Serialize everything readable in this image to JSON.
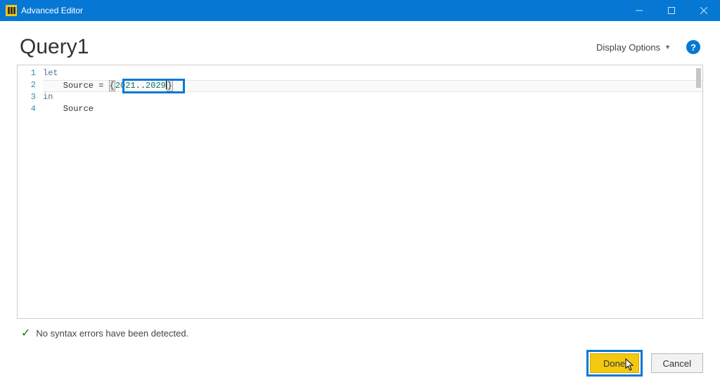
{
  "titlebar": {
    "title": "Advanced Editor"
  },
  "header": {
    "query_name": "Query1",
    "display_options_label": "Display Options",
    "help_char": "?"
  },
  "editor": {
    "line_numbers": [
      "1",
      "2",
      "3",
      "4"
    ],
    "lines": {
      "l1_kw": "let",
      "l2_prefix": "    Source = ",
      "l2_brace_open": "{",
      "l2_num1": "2021",
      "l2_dots": "..",
      "l2_num2": "2029",
      "l2_brace_close": "}",
      "l3_kw": "in",
      "l4": "    Source"
    }
  },
  "status": {
    "message": "No syntax errors have been detected."
  },
  "buttons": {
    "done": "Done",
    "cancel": "Cancel"
  }
}
